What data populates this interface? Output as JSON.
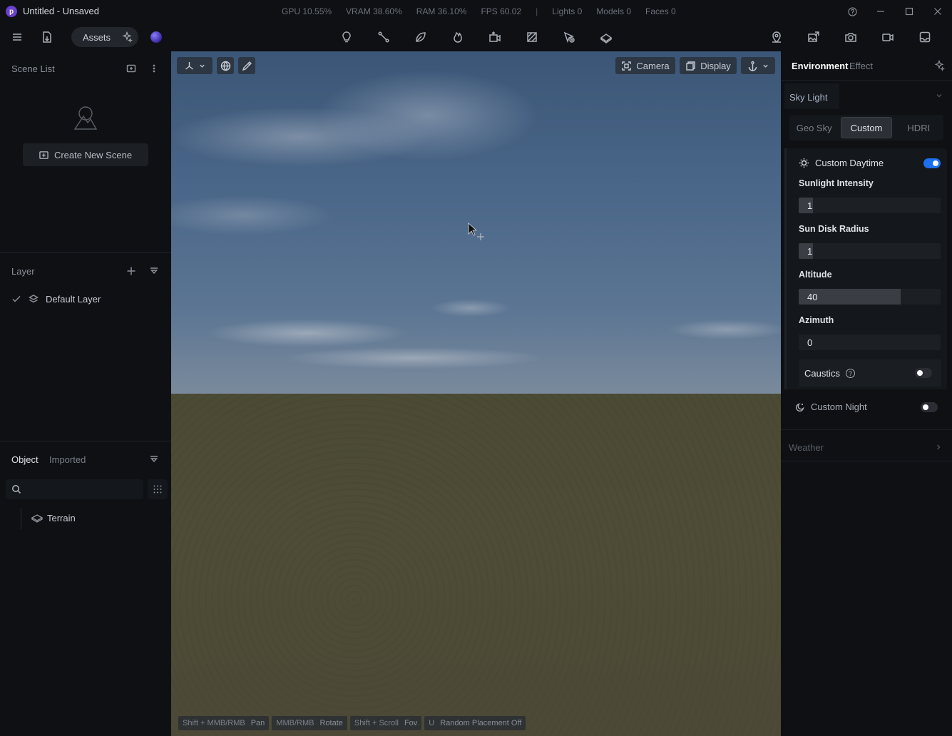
{
  "window": {
    "logo_letter": "p",
    "title": "Untitled - Unsaved",
    "stats": [
      "GPU 10.55%",
      "VRAM 38.60%",
      "RAM 36.10%",
      "FPS 60.02",
      "Lights 0",
      "Models 0",
      "Faces 0"
    ],
    "separator": "|"
  },
  "toolbar": {
    "assets_label": "Assets"
  },
  "left": {
    "scene_list_title": "Scene List",
    "create_scene_label": "Create New Scene",
    "layer_title": "Layer",
    "layers": [
      {
        "name": "Default Layer"
      }
    ],
    "object_tab": "Object",
    "imported_tab": "Imported",
    "search_placeholder": "",
    "objects": [
      {
        "name": "Terrain"
      }
    ]
  },
  "viewport": {
    "camera_label": "Camera",
    "display_label": "Display",
    "hints": [
      {
        "key": "Shift + MMB/RMB",
        "action": "Pan"
      },
      {
        "key": "MMB/RMB",
        "action": "Rotate"
      },
      {
        "key": "Shift + Scroll",
        "action": "Fov"
      },
      {
        "key": "U",
        "action": "Random Placement Off"
      }
    ]
  },
  "right": {
    "tab_environment": "Environment",
    "tab_effect": "Effect",
    "sky_light_title": "Sky Light",
    "sky_modes": [
      "Geo Sky",
      "Custom",
      "HDRI"
    ],
    "active_sky_mode": "Custom",
    "custom_daytime": {
      "label": "Custom Daytime",
      "enabled": true
    },
    "fields": [
      {
        "label": "Sunlight Intensity",
        "value": "1",
        "fill_fraction": 0.1
      },
      {
        "label": "Sun Disk Radius",
        "value": "1",
        "fill_fraction": 0.1
      },
      {
        "label": "Altitude",
        "value": "40",
        "fill_fraction": 0.72
      },
      {
        "label": "Azimuth",
        "value": "0",
        "fill_fraction": 0.0
      }
    ],
    "caustics": {
      "label": "Caustics",
      "enabled": false,
      "help_glyph": "?"
    },
    "custom_night": {
      "label": "Custom Night",
      "enabled": false
    },
    "weather_title": "Weather"
  },
  "colors": {
    "accent": "#1b6ff0",
    "background": "#0e1014",
    "panel": "#14171b"
  }
}
